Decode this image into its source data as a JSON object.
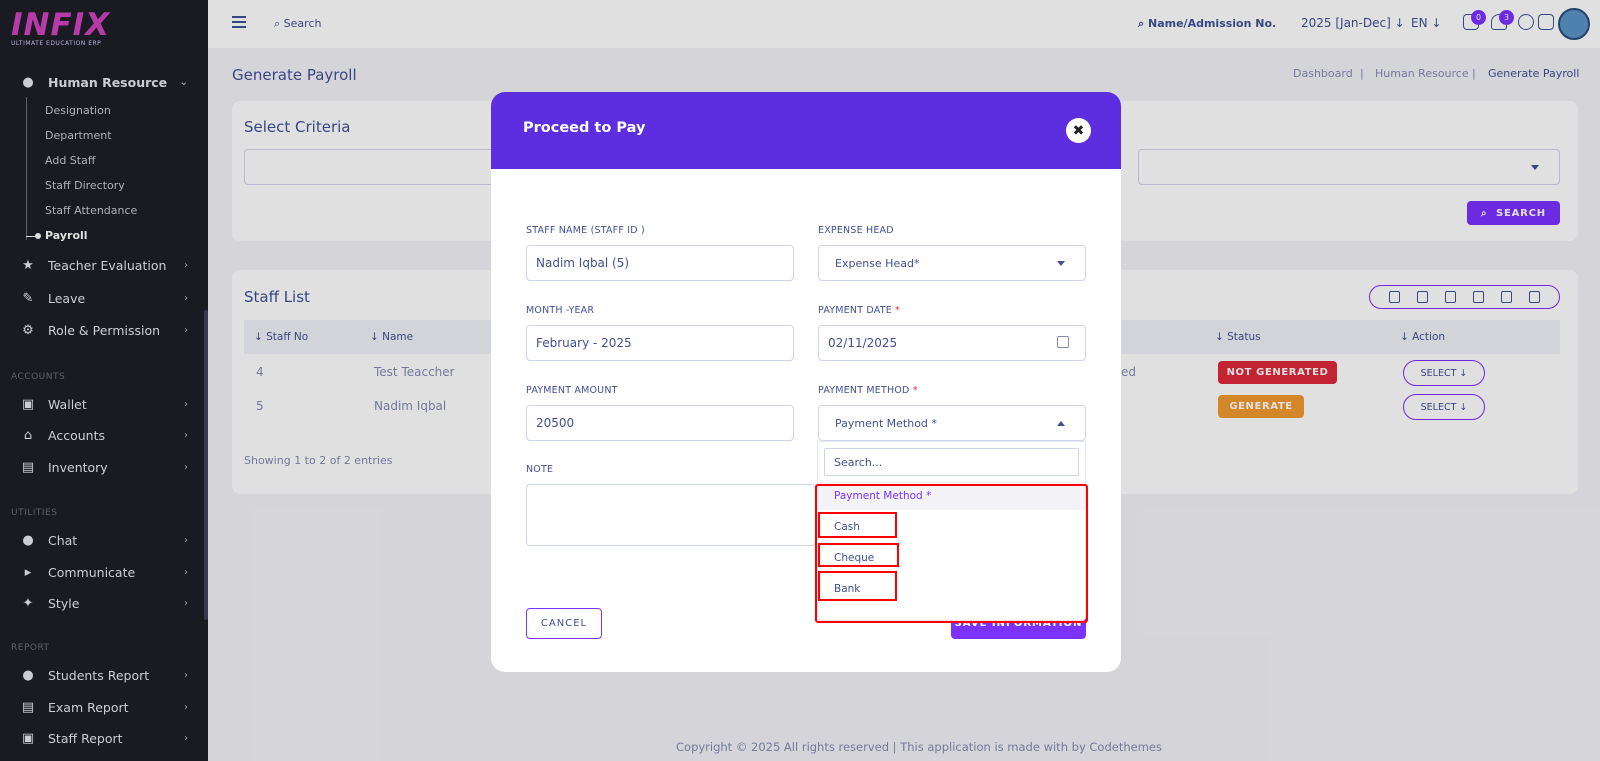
{
  "sidebar": {
    "logo": "INFIX",
    "logo_sub": "ULTIMATE EDUCATION ERP",
    "human_resource": "Human Resource",
    "sub_items": [
      "Designation",
      "Department",
      "Add Staff",
      "Staff Directory",
      "Staff Attendance",
      "Payroll"
    ],
    "teacher_evaluation": "Teacher Evaluation",
    "leave": "Leave",
    "role_permission": "Role & Permission",
    "section_accounts": "ACCOUNTS",
    "wallet": "Wallet",
    "accounts": "Accounts",
    "inventory": "Inventory",
    "section_utilities": "UTILITIES",
    "chat": "Chat",
    "communicate": "Communicate",
    "style": "Style",
    "section_report": "REPORT",
    "students_report": "Students Report",
    "exam_report": "Exam Report",
    "staff_report": "Staff Report"
  },
  "topbar": {
    "search": "Search",
    "search_student": "Name/Admission No.",
    "year": "2025 [Jan-Dec]",
    "lang": "EN",
    "msg_count": "0",
    "notif_count": "3"
  },
  "page": {
    "title": "Generate Payroll",
    "breadcrumb": [
      "Dashboard",
      "Human Resource",
      "Generate Payroll"
    ],
    "select_criteria": "Select Criteria",
    "search_button": "SEARCH",
    "staff_list": "Staff List",
    "columns": [
      "Staff No",
      "Name",
      "Status",
      "Action"
    ],
    "rows": [
      {
        "staff_no": "4",
        "name": "Test Teaccher",
        "role_tail": "ed",
        "status": "NOT GENERATED",
        "action": "SELECT"
      },
      {
        "staff_no": "5",
        "name": "Nadim Iqbal",
        "role_tail": "",
        "status": "GENERATE",
        "action": "SELECT"
      }
    ],
    "showing": "Showing 1 to 2 of 2 entries",
    "footer": "Copyright © 2025 All rights reserved | This application is made with by Codethemes"
  },
  "modal": {
    "title": "Proceed to Pay",
    "staff_name_label": "STAFF NAME (STAFF ID )",
    "staff_name_value": "Nadim Iqbal (5)",
    "expense_head_label": "EXPENSE HEAD",
    "expense_head_value": "Expense Head*",
    "month_year_label": "MONTH -YEAR",
    "month_year_value": "February - 2025",
    "payment_date_label": "PAYMENT DATE",
    "payment_date_value": "02/11/2025",
    "payment_amount_label": "PAYMENT AMOUNT",
    "payment_amount_value": "20500",
    "payment_method_label": "PAYMENT METHOD",
    "payment_method_value": "Payment Method *",
    "note_label": "NOTE",
    "cancel": "CANCEL",
    "save": "SAVE INFORMATION",
    "dropdown_search_placeholder": "Search...",
    "dropdown_options": [
      "Payment Method *",
      "Cash",
      "Cheque",
      "Bank"
    ],
    "required_mark": "*"
  },
  "colors": {
    "accent": "#7c32ff",
    "modal_header": "#5d2ee0",
    "not_generated": "#e0283b",
    "generate": "#f29a2e",
    "highlight": "#ff0000"
  }
}
